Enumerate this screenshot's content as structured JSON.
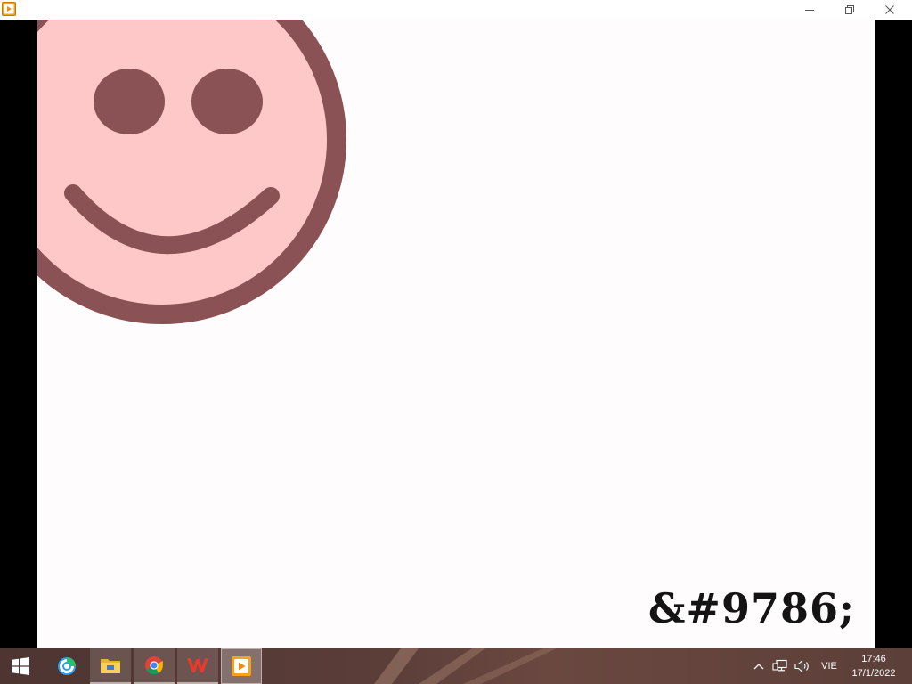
{
  "window": {
    "app_icon": "media-player-icon",
    "minimize_icon": "minimize-icon",
    "restore_icon": "restore-icon",
    "close_icon": "close-icon"
  },
  "video": {
    "image": "smiley-face",
    "face_color": "#ffc8c8",
    "outline_color": "#8b5256",
    "caption": "&#9786;"
  },
  "taskbar": {
    "start_icon": "windows-start-icon",
    "pinned": [
      {
        "icon": "coccoc-browser-icon"
      },
      {
        "icon": "file-explorer-icon"
      },
      {
        "icon": "chrome-icon"
      },
      {
        "icon": "wps-office-icon"
      },
      {
        "icon": "media-player-icon"
      }
    ],
    "tray": {
      "chevron_icon": "chevron-up-icon",
      "network_icon": "network-icon",
      "volume_icon": "volume-icon",
      "language": "VIE",
      "time": "17:46",
      "date": "17/1/2022"
    }
  }
}
